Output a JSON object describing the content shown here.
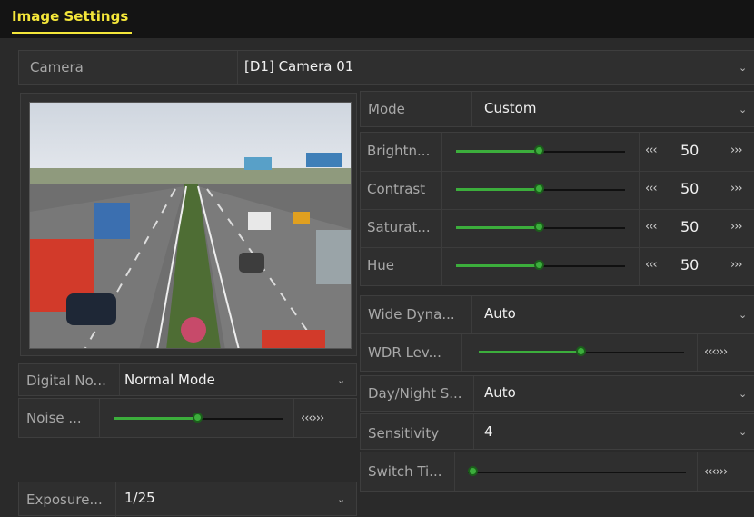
{
  "window": {
    "title": "Image Settings"
  },
  "camera": {
    "label": "Camera",
    "value": "[D1] Camera 01"
  },
  "mode": {
    "label": "Mode",
    "value": "Custom"
  },
  "adjustments": [
    {
      "label": "Brightn...",
      "value": "50",
      "level": 50
    },
    {
      "label": "Contrast",
      "value": "50",
      "level": 50
    },
    {
      "label": "Saturat...",
      "value": "50",
      "level": 50
    },
    {
      "label": "Hue",
      "value": "50",
      "level": 50
    }
  ],
  "wdr": {
    "label": "Wide Dyna...",
    "value": "Auto"
  },
  "wdr_level": {
    "label": "WDR Lev...",
    "level": 50
  },
  "digital_noise": {
    "label": "Digital No...",
    "value": "Normal Mode"
  },
  "noise_level": {
    "label": "Noise ...",
    "level": 50
  },
  "day_night": {
    "label": "Day/Night S...",
    "value": "Auto"
  },
  "sensitivity": {
    "label": "Sensitivity",
    "value": "4"
  },
  "switch_time": {
    "label": "Switch Ti...",
    "level": 0
  },
  "exposure": {
    "label": "Exposure...",
    "value": "1/25"
  },
  "controls": {
    "dec": "‹‹‹",
    "inc": "›››",
    "stepper": "‹‹‹›››"
  },
  "icons": {
    "dropdown": "chevron-down-icon"
  },
  "colors": {
    "accent": "#f4e63a",
    "slider": "#3cae3c"
  }
}
